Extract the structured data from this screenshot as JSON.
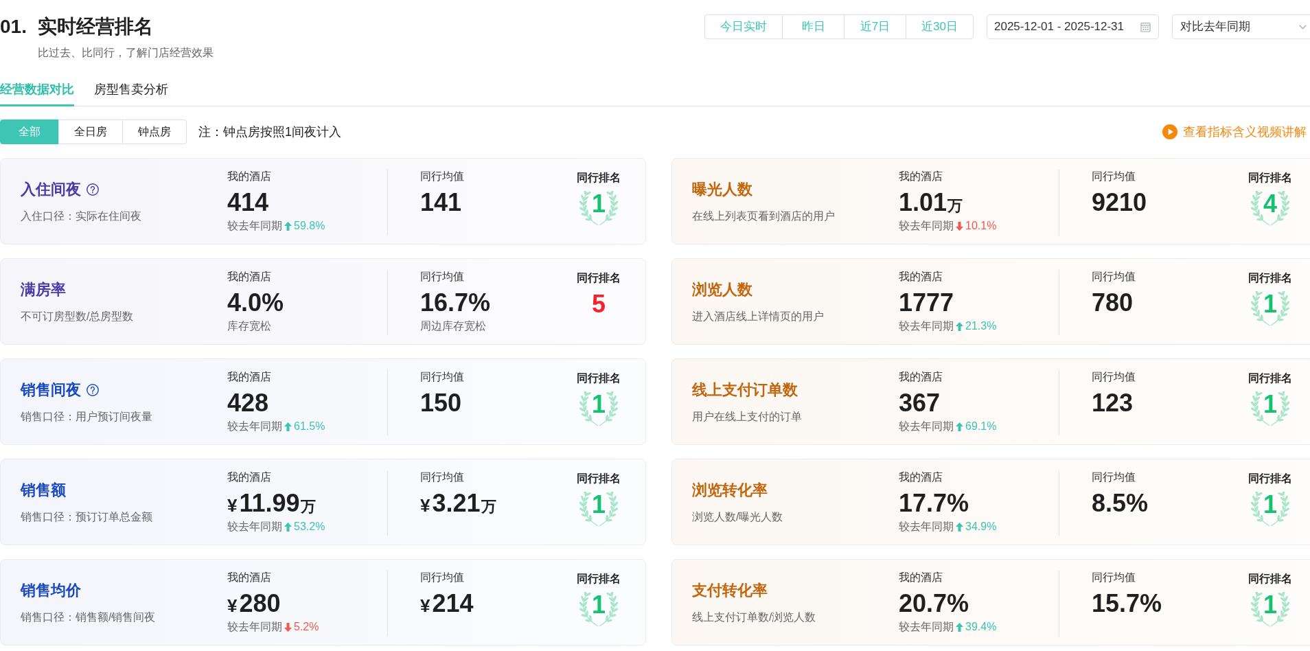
{
  "header": {
    "number": "01.",
    "title": "实时经营排名",
    "subtitle": "比过去、比同行，了解门店经营效果"
  },
  "period_buttons": [
    {
      "label": "今日实时",
      "selected": false
    },
    {
      "label": "昨日",
      "selected": false
    },
    {
      "label": "近7日",
      "selected": false
    },
    {
      "label": "近30日",
      "selected": false
    }
  ],
  "date_range": {
    "value": "2025-12-01 - 2025-12-31"
  },
  "compare_select": {
    "value": "对比去年同期"
  },
  "tabs": [
    {
      "label": "经营数据对比",
      "selected": true
    },
    {
      "label": "房型售卖分析",
      "selected": false
    }
  ],
  "room_filter": [
    {
      "label": "全部",
      "selected": true
    },
    {
      "label": "全日房",
      "selected": false
    },
    {
      "label": "钟点房",
      "selected": false
    }
  ],
  "note": "注：钟点房按照1间夜计入",
  "video_link": "查看指标含义视频讲解",
  "columns": [
    {
      "cards": [
        {
          "title": "入住间夜",
          "color": "#4a3aa8",
          "help": true,
          "description": "入住口径：实际在住间夜",
          "mine": {
            "label": "我的酒店",
            "value": "414",
            "change": {
              "label": "较去年同期",
              "rising": true,
              "value": "59.8%"
            }
          },
          "peer": {
            "label": "同行均值",
            "value": "141"
          },
          "rank": {
            "label": "同行排名",
            "value": "1",
            "laurel": true
          }
        },
        {
          "title": "满房率",
          "color": "#4a3aa8",
          "help": false,
          "description": "不可订房型数/总房型数",
          "mine": {
            "label": "我的酒店",
            "value": "4.0%",
            "note": "库存宽松"
          },
          "peer": {
            "label": "同行均值",
            "value": "16.7%",
            "note": "周边库存宽松"
          },
          "rank": {
            "label": "同行排名",
            "value": "5",
            "laurel": false
          }
        },
        {
          "title": "销售间夜",
          "color": "#1a48c2",
          "help": true,
          "description": "销售口径：用户预订间夜量",
          "mine": {
            "label": "我的酒店",
            "value": "428",
            "change": {
              "label": "较去年同期",
              "rising": true,
              "value": "61.5%"
            }
          },
          "peer": {
            "label": "同行均值",
            "value": "150"
          },
          "rank": {
            "label": "同行排名",
            "value": "1",
            "laurel": true
          }
        },
        {
          "title": "销售额",
          "color": "#1a48c2",
          "help": false,
          "description": "销售口径：预订订单总金额",
          "mine": {
            "label": "我的酒店",
            "prefix": "¥",
            "value": "11.99",
            "unit": "万",
            "change": {
              "label": "较去年同期",
              "rising": true,
              "value": "53.2%"
            }
          },
          "peer": {
            "label": "同行均值",
            "prefix": "¥",
            "value": "3.21",
            "unit": "万"
          },
          "rank": {
            "label": "同行排名",
            "value": "1",
            "laurel": true
          }
        },
        {
          "title": "销售均价",
          "color": "#1a48c2",
          "help": false,
          "description": "销售口径：销售额/销售间夜",
          "mine": {
            "label": "我的酒店",
            "prefix": "¥",
            "value": "280",
            "change": {
              "label": "较去年同期",
              "rising": false,
              "value": "5.2%"
            }
          },
          "peer": {
            "label": "同行均值",
            "prefix": "¥",
            "value": "214"
          },
          "rank": {
            "label": "同行排名",
            "value": "1",
            "laurel": true
          }
        }
      ]
    },
    {
      "cards": [
        {
          "title": "曝光人数",
          "color": "#c2650c",
          "help": false,
          "description": "在线上列表页看到酒店的用户",
          "mine": {
            "label": "我的酒店",
            "value": "1.01",
            "unit": "万",
            "change": {
              "label": "较去年同期",
              "rising": false,
              "value": "10.1%"
            }
          },
          "peer": {
            "label": "同行均值",
            "value": "9210"
          },
          "rank": {
            "label": "同行排名",
            "value": "4",
            "laurel": true
          }
        },
        {
          "title": "浏览人数",
          "color": "#c2650c",
          "help": false,
          "description": "进入酒店线上详情页的用户",
          "mine": {
            "label": "我的酒店",
            "value": "1777",
            "change": {
              "label": "较去年同期",
              "rising": true,
              "value": "21.3%"
            }
          },
          "peer": {
            "label": "同行均值",
            "value": "780"
          },
          "rank": {
            "label": "同行排名",
            "value": "1",
            "laurel": true
          }
        },
        {
          "title": "线上支付订单数",
          "color": "#c2650c",
          "help": false,
          "description": "用户在线上支付的订单",
          "mine": {
            "label": "我的酒店",
            "value": "367",
            "change": {
              "label": "较去年同期",
              "rising": true,
              "value": "69.1%"
            }
          },
          "peer": {
            "label": "同行均值",
            "value": "123"
          },
          "rank": {
            "label": "同行排名",
            "value": "1",
            "laurel": true
          }
        },
        {
          "title": "浏览转化率",
          "color": "#c2650c",
          "help": false,
          "description": "浏览人数/曝光人数",
          "mine": {
            "label": "我的酒店",
            "value": "17.7%",
            "change": {
              "label": "较去年同期",
              "rising": true,
              "value": "34.9%"
            }
          },
          "peer": {
            "label": "同行均值",
            "value": "8.5%"
          },
          "rank": {
            "label": "同行排名",
            "value": "1",
            "laurel": true
          }
        },
        {
          "title": "支付转化率",
          "color": "#c2650c",
          "help": false,
          "description": "线上支付订单数/浏览人数",
          "mine": {
            "label": "我的酒店",
            "value": "20.7%",
            "change": {
              "label": "较去年同期",
              "rising": true,
              "value": "39.4%"
            }
          },
          "peer": {
            "label": "同行均值",
            "value": "15.7%"
          },
          "rank": {
            "label": "同行排名",
            "value": "1",
            "laurel": true
          }
        }
      ]
    }
  ]
}
